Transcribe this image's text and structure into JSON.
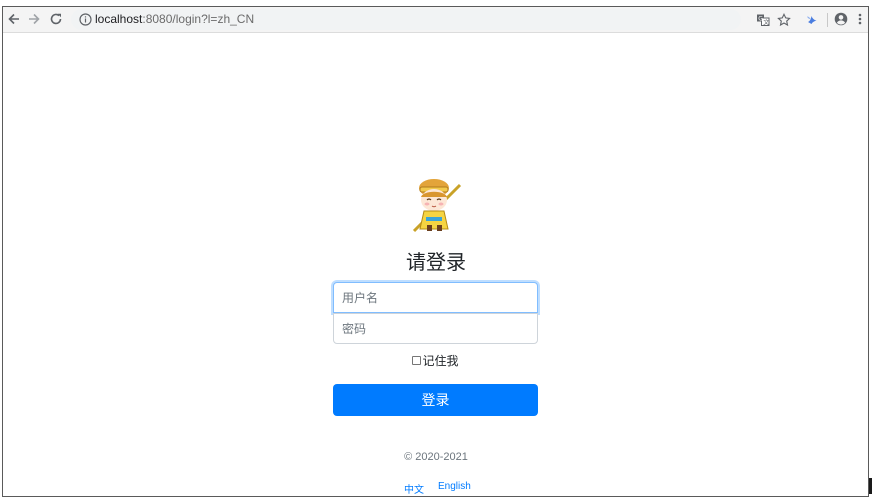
{
  "browser": {
    "url_host": "localhost",
    "url_path": ":8080/login?l=zh_CN",
    "icons": [
      "back-arrow-icon",
      "forward-arrow-icon",
      "reload-icon",
      "info-icon",
      "translate-icon",
      "star-icon",
      "extension-icon",
      "account-icon",
      "menu-icon"
    ]
  },
  "login": {
    "heading": "请登录",
    "username_placeholder": "用户名",
    "password_placeholder": "密码",
    "remember_label": "记住我",
    "submit_label": "登录",
    "copyright": "© 2020-2021",
    "lang_zh": "中文",
    "lang_en": "English"
  },
  "colors": {
    "primary": "#007bff",
    "focus_border": "#80bdff",
    "muted_text": "#6c757d"
  }
}
